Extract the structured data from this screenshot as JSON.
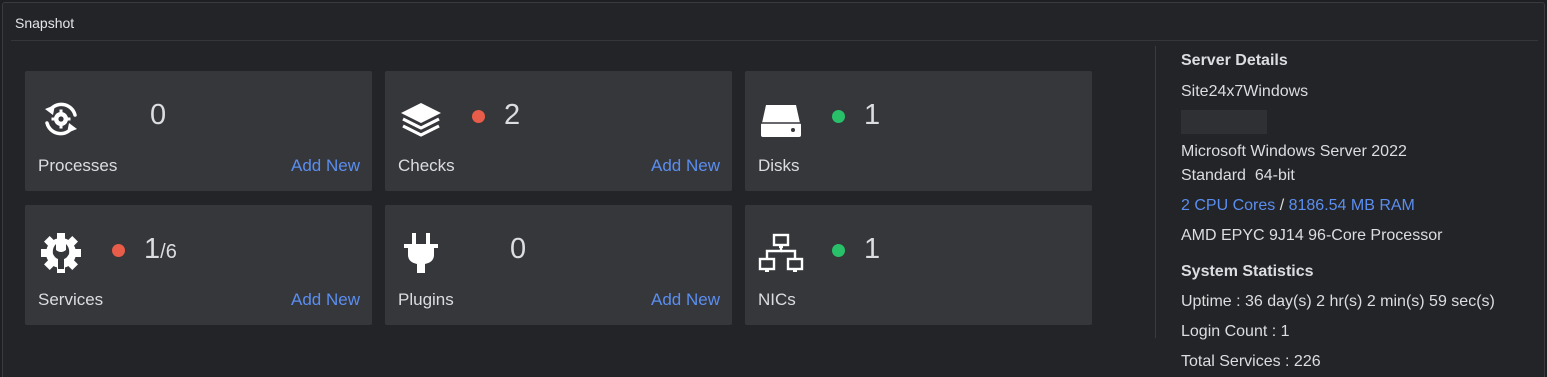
{
  "panel": {
    "title": "Snapshot"
  },
  "colors": {
    "accent": "#5a8ef0",
    "status_red": "#e85c4a",
    "status_green": "#29c06a"
  },
  "cards": {
    "processes": {
      "label": "Processes",
      "count": "0",
      "action": "Add New",
      "icon": "refresh-gear-icon"
    },
    "checks": {
      "label": "Checks",
      "count": "2",
      "action": "Add New",
      "icon": "layers-icon",
      "status": "red"
    },
    "disks": {
      "label": "Disks",
      "count": "1",
      "icon": "hard-drive-icon",
      "status": "green"
    },
    "services": {
      "label": "Services",
      "count": "1",
      "total": "/6",
      "action": "Add New",
      "icon": "gear-wrench-icon",
      "status": "red"
    },
    "plugins": {
      "label": "Plugins",
      "count": "0",
      "action": "Add New",
      "icon": "plug-icon"
    },
    "nics": {
      "label": "NICs",
      "count": "1",
      "icon": "network-icon",
      "status": "green"
    }
  },
  "server": {
    "heading": "Server Details",
    "name": "Site24x7Windows",
    "os_line1": "Microsoft Windows Server 2022",
    "os_line2": "Standard  64-bit",
    "cpu": "2 CPU Cores",
    "separator": " / ",
    "ram": "8186.54 MB RAM",
    "processor": "AMD EPYC 9J14 96-Core Processor"
  },
  "stats": {
    "heading": "System Statistics",
    "uptime": "Uptime : 36 day(s) 2 hr(s) 2 min(s) 59 sec(s)",
    "login_count": "Login Count : 1",
    "total_services": "Total Services : 226"
  }
}
